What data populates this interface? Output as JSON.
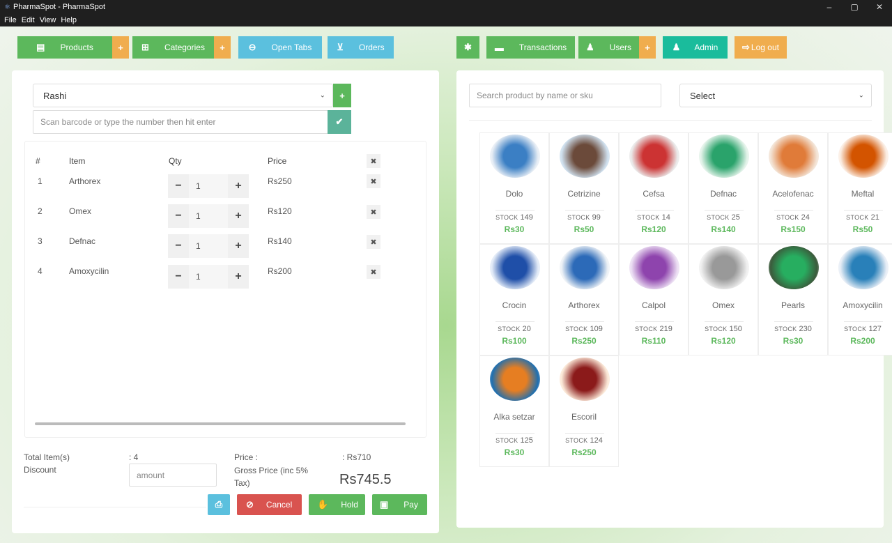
{
  "window": {
    "title": "PharmaSpot - PharmaSpot",
    "controls": [
      "–",
      "▢",
      "✕"
    ]
  },
  "menu": [
    "File",
    "Edit",
    "View",
    "Help"
  ],
  "toolbar": {
    "products": "Products",
    "categories": "Categories",
    "open_tabs": "Open Tabs",
    "orders": "Orders",
    "transactions": "Transactions",
    "users": "Users",
    "admin": "Admin",
    "logout": "Log out"
  },
  "cart": {
    "customer": "Rashi",
    "barcode_placeholder": "Scan barcode or type the number then hit enter",
    "headers": {
      "num": "#",
      "item": "Item",
      "qty": "Qty",
      "price": "Price"
    },
    "items": [
      {
        "num": "1",
        "name": "Arthorex",
        "qty": "1",
        "price": "Rs250"
      },
      {
        "num": "2",
        "name": "Omex",
        "qty": "1",
        "price": "Rs120"
      },
      {
        "num": "3",
        "name": "Defnac",
        "qty": "1",
        "price": "Rs140"
      },
      {
        "num": "4",
        "name": "Amoxycilin",
        "qty": "1",
        "price": "Rs200"
      }
    ]
  },
  "summary": {
    "total_items_label": "Total Item(s)",
    "total_items_value": ": 4",
    "discount_label": "Discount",
    "discount_placeholder": "amount",
    "price_label": "Price :",
    "price_value": ": Rs710",
    "gross_label": "Gross Price (inc 5% Tax)",
    "gross_value": "Rs745.5"
  },
  "actions": {
    "cancel": "Cancel",
    "hold": "Hold",
    "pay": "Pay"
  },
  "search": {
    "placeholder": "Search product by name or sku",
    "category_select": "Select"
  },
  "stock_label": "STOCK",
  "products": [
    {
      "name": "Dolo",
      "stock": "149",
      "price": "Rs30"
    },
    {
      "name": "Cetrizine",
      "stock": "99",
      "price": "Rs50"
    },
    {
      "name": "Cefsa",
      "stock": "14",
      "price": "Rs120"
    },
    {
      "name": "Defnac",
      "stock": "25",
      "price": "Rs140"
    },
    {
      "name": "Acelofenac",
      "stock": "24",
      "price": "Rs150"
    },
    {
      "name": "Meftal",
      "stock": "21",
      "price": "Rs50"
    },
    {
      "name": "Crocin",
      "stock": "20",
      "price": "Rs100"
    },
    {
      "name": "Arthorex",
      "stock": "109",
      "price": "Rs250"
    },
    {
      "name": "Calpol",
      "stock": "219",
      "price": "Rs110"
    },
    {
      "name": "Omex",
      "stock": "150",
      "price": "Rs120"
    },
    {
      "name": "Pearls",
      "stock": "230",
      "price": "Rs30"
    },
    {
      "name": "Amoxycilin",
      "stock": "127",
      "price": "Rs200"
    },
    {
      "name": "Alka setzar",
      "stock": "125",
      "price": "Rs30"
    },
    {
      "name": "Escoril",
      "stock": "124",
      "price": "Rs250"
    }
  ],
  "colors": {
    "green": "#5cb85c",
    "orange": "#f0ad4e",
    "cyan": "#5bc0de",
    "red": "#d9534f",
    "teal": "#1abc9c"
  }
}
